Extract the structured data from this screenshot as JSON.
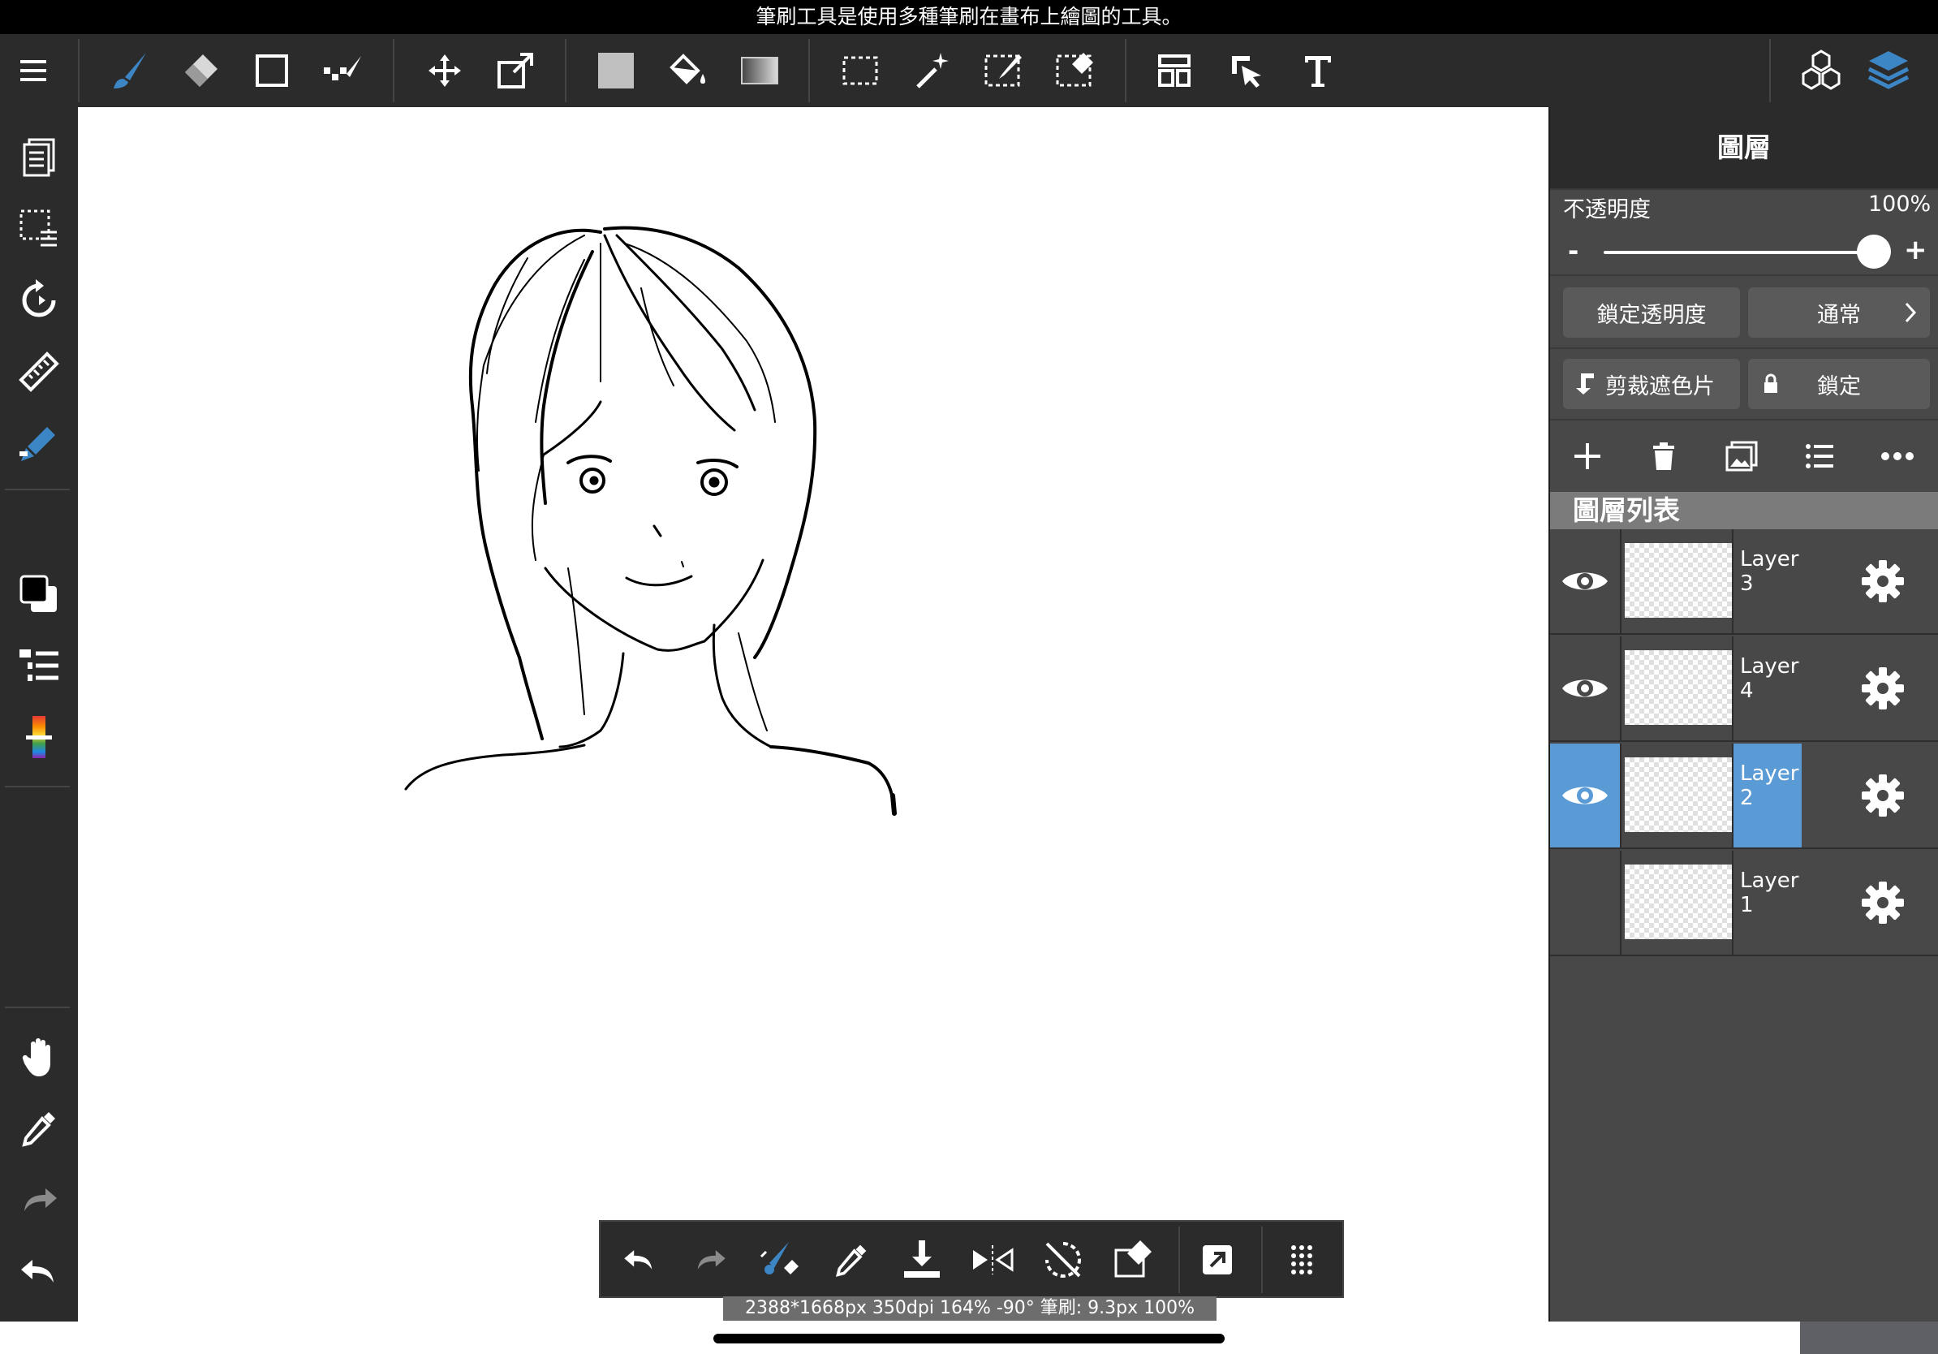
{
  "tooltip": "筆刷工具是使用多種筆刷在畫布上繪圖的工具。",
  "toolbar": {
    "tools": [
      "menu-icon",
      "brush-icon",
      "eraser-icon",
      "shape-icon",
      "dot-icon",
      "move-icon",
      "transform-icon",
      "fill-color-icon",
      "bucket-icon",
      "gradient-icon",
      "select-rect-icon",
      "magic-wand-icon",
      "select-pen-icon",
      "select-eraser-icon",
      "layout-icon",
      "operation-icon",
      "text-icon"
    ],
    "right": [
      "3d-material-icon",
      "layers-icon"
    ]
  },
  "left_toolbar": {
    "tools": [
      "page-icon",
      "selection-layer-icon",
      "rotate-icon",
      "ruler-icon",
      "brush-snap-icon",
      "color-icon",
      "brush-list-icon",
      "palette-icon",
      "hand-icon",
      "eyedropper-icon",
      "redo-icon",
      "undo-icon"
    ]
  },
  "panel": {
    "title": "圖層",
    "opacity_label": "不透明度",
    "opacity_value": "100%",
    "opacity_fraction": 1.0,
    "minus": "-",
    "plus": "+",
    "lock_alpha": "鎖定透明度",
    "blend_mode": "通常",
    "clipping": "剪裁遮色片",
    "lock": "鎖定",
    "list_header": "圖層列表",
    "layers": [
      {
        "name": "Layer",
        "num": "3",
        "visible": true,
        "active": false
      },
      {
        "name": "Layer",
        "num": "4",
        "visible": true,
        "active": false
      },
      {
        "name": "Layer",
        "num": "2",
        "visible": true,
        "active": true
      },
      {
        "name": "Layer",
        "num": "1",
        "visible": false,
        "active": false
      }
    ],
    "accent": "#5b9bd5"
  },
  "bottom_bar": {
    "tools": [
      "undo-icon",
      "redo-icon",
      "brush-size-icon",
      "eyedropper-icon",
      "save-icon",
      "flip-icon",
      "rotate-reset-icon",
      "clear-icon",
      "fullscreen-icon",
      "more-icon"
    ]
  },
  "status": "2388*1668px 350dpi 164% -90° 筆刷: 9.3px 100%"
}
